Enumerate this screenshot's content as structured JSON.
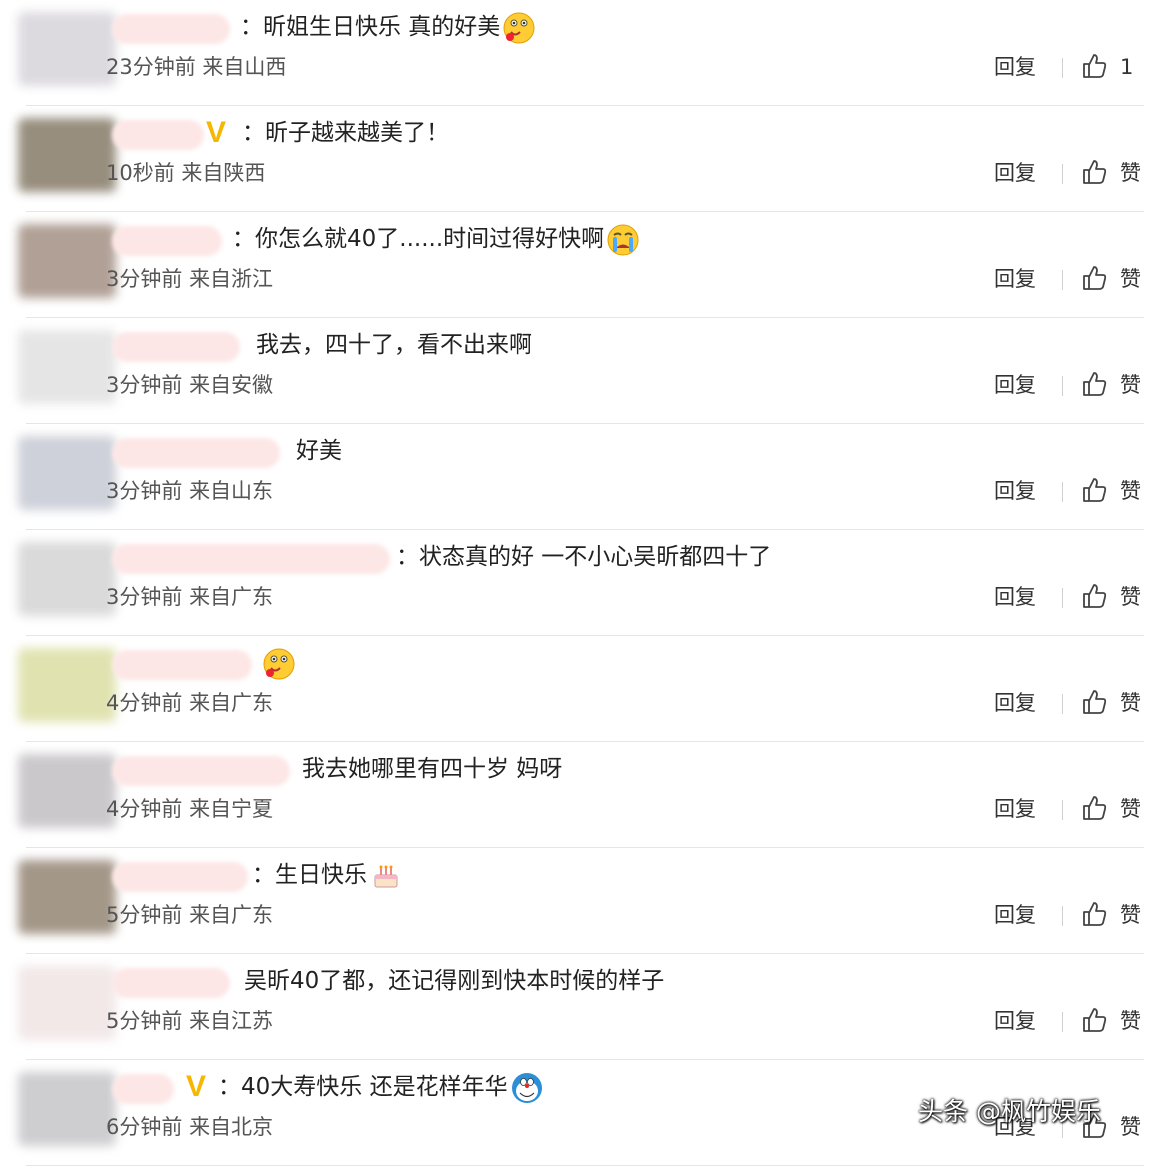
{
  "comments": [
    {
      "text": "：昕姐生日快乐 真的好美",
      "time": "23分钟前",
      "location": "来自山西",
      "reply": "回复",
      "like": "1",
      "emoji": "drooling-face-icon",
      "vip": false
    },
    {
      "text": "：昕子越来越美了！",
      "time": "10秒前",
      "location": "来自陕西",
      "reply": "回复",
      "like": "赞",
      "emoji": "",
      "vip": true
    },
    {
      "text": "：你怎么就40了......时间过得好快啊",
      "time": "3分钟前",
      "location": "来自浙江",
      "reply": "回复",
      "like": "赞",
      "emoji": "crying-face-icon",
      "vip": false
    },
    {
      "text": "我去，四十了，看不出来啊",
      "time": "3分钟前",
      "location": "来自安徽",
      "reply": "回复",
      "like": "赞",
      "emoji": "",
      "vip": false
    },
    {
      "text": "好美",
      "time": "3分钟前",
      "location": "来自山东",
      "reply": "回复",
      "like": "赞",
      "emoji": "",
      "vip": false
    },
    {
      "text": "：状态真的好 一不小心吴昕都四十了",
      "time": "3分钟前",
      "location": "来自广东",
      "reply": "回复",
      "like": "赞",
      "emoji": "",
      "vip": false
    },
    {
      "text": "",
      "time": "4分钟前",
      "location": "来自广东",
      "reply": "回复",
      "like": "赞",
      "emoji": "drooling-face-icon",
      "vip": false
    },
    {
      "text": "我去她哪里有四十岁 妈呀",
      "time": "4分钟前",
      "location": "来自宁夏",
      "reply": "回复",
      "like": "赞",
      "emoji": "",
      "vip": false
    },
    {
      "text": "：生日快乐",
      "time": "5分钟前",
      "location": "来自广东",
      "reply": "回复",
      "like": "赞",
      "emoji": "cake-icon",
      "vip": false
    },
    {
      "text": "吴昕40了都，还记得刚到快本时候的样子",
      "time": "5分钟前",
      "location": "来自江苏",
      "reply": "回复",
      "like": "赞",
      "emoji": "",
      "vip": false
    },
    {
      "text": "：40大寿快乐 还是花样年华",
      "time": "6分钟前",
      "location": "来自北京",
      "reply": "回复",
      "like": "赞",
      "emoji": "doraemon-icon",
      "vip": true
    }
  ],
  "colors": {
    "vip_badge": "#f5b700",
    "separator": "#e6e6e6",
    "meta_text": "#555555"
  },
  "watermark": "头条 @枫竹娱乐"
}
